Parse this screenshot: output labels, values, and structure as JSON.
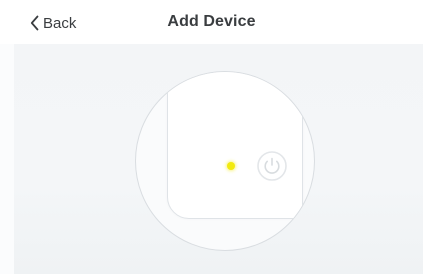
{
  "nav": {
    "back_label": "Back",
    "title": "Add Device"
  },
  "device": {
    "led_color": "#f2ea0e",
    "icons": [
      "chevron-left-icon",
      "power-icon"
    ]
  }
}
